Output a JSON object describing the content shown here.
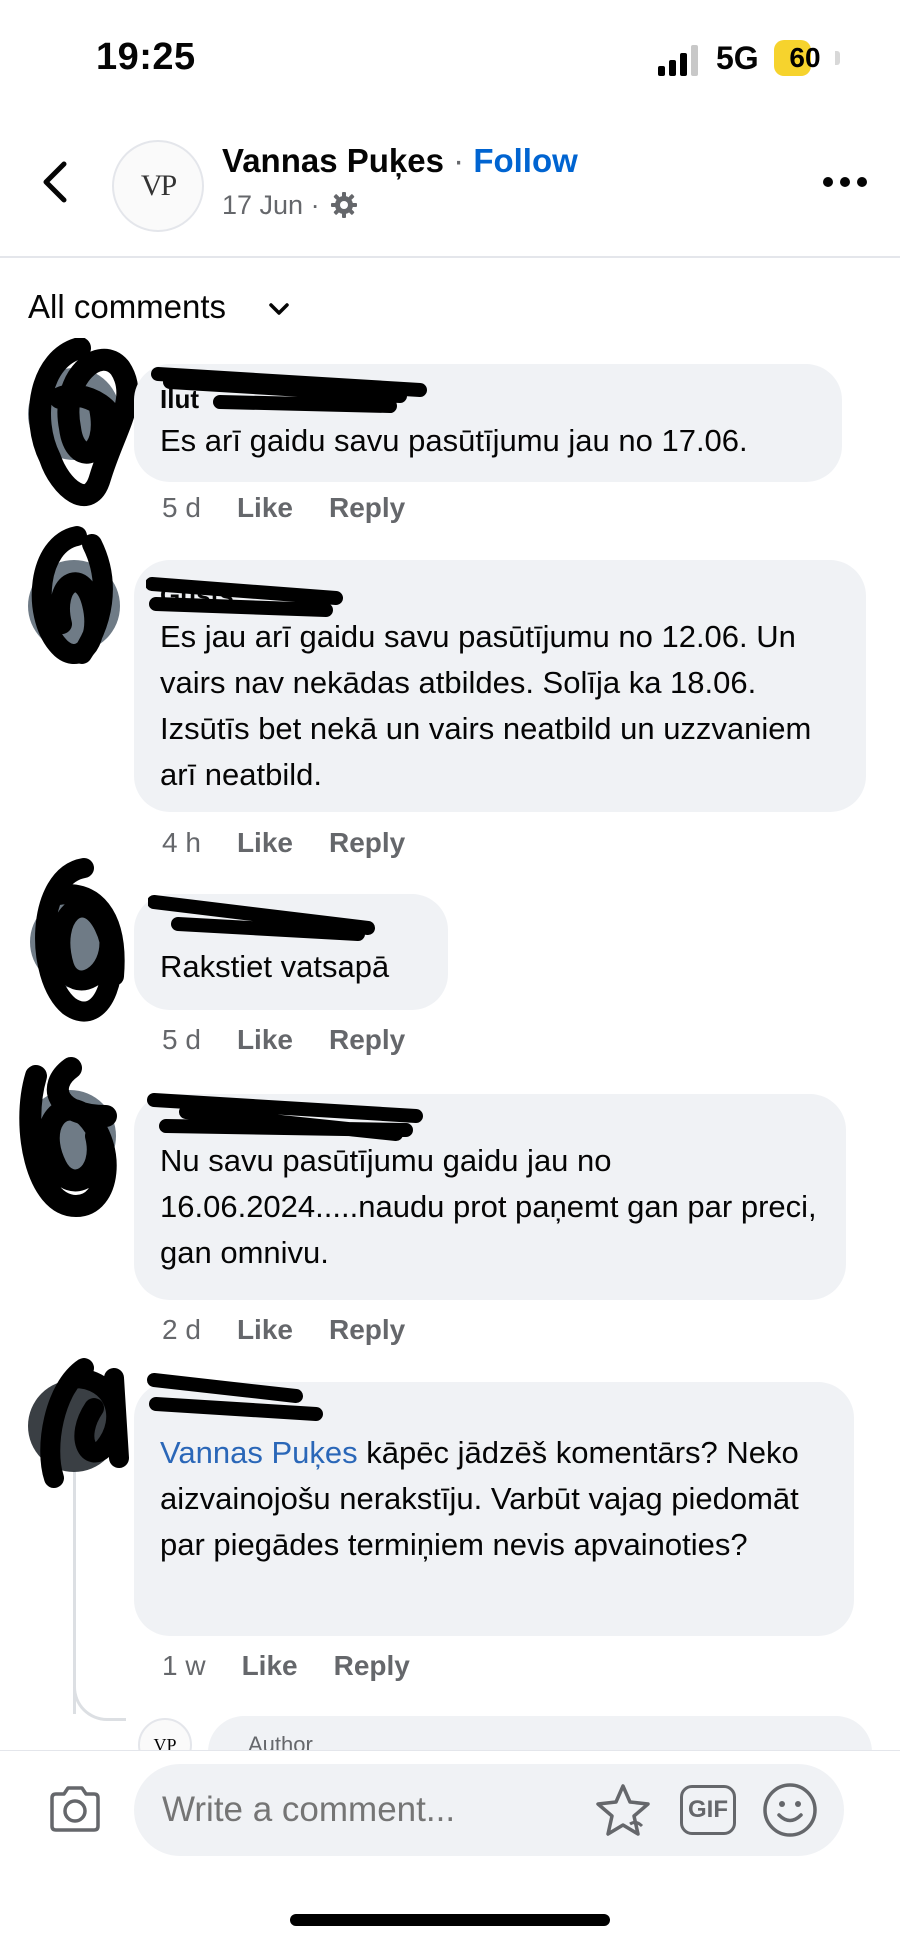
{
  "status_bar": {
    "time": "19:25",
    "network": "5G",
    "battery": "60",
    "battery_level": 0.6
  },
  "header": {
    "page_name": "Vannas Puķes",
    "separator": "·",
    "follow_label": "Follow",
    "date": "17 Jun ·",
    "avatar_text": "VP"
  },
  "filter": {
    "label": "All comments"
  },
  "comments": [
    {
      "author": "Ilut",
      "text": "Es arī gaidu savu pasūtījumu jau no 17.06.",
      "time": "5 d",
      "like": "Like",
      "reply": "Reply"
    },
    {
      "author": "Gusts",
      "text": "Es jau arī gaidu savu pasūtījumu no 12.06. Un vairs nav nekādas atbildes. Solīja ka 18.06. Izsūtīs bet nekā  un vairs neatbild un uzzvaniem arī neatbild.",
      "time": "4 h",
      "like": "Like",
      "reply": "Reply"
    },
    {
      "author": "",
      "text": "Rakstiet vatsapā",
      "time": "5 d",
      "like": "Like",
      "reply": "Reply"
    },
    {
      "author": "",
      "text": "Nu savu pasūtījumu gaidu jau no 16.06.2024.....naudu prot paņemt gan par preci, gan omnivu.",
      "time": "2 d",
      "like": "Like",
      "reply": "Reply"
    },
    {
      "author": "",
      "mention": "Vannas Puķes",
      "text": " kāpēc jādzēš komentārs? Neko aizvainojošu nerakstīju. Varbūt vajag piedomāt par piegādes termiņiem nevis apvainoties?",
      "time": "1 w",
      "like": "Like",
      "reply": "Reply"
    }
  ],
  "reply_preview": {
    "author_badge": "Author",
    "avatar_text": "VP"
  },
  "composer": {
    "placeholder": "Write a comment...",
    "gif_label": "GIF"
  },
  "colors": {
    "accent": "#0064d1",
    "bubble": "#f0f2f5",
    "muted": "#65676b",
    "battery": "#f6d32d"
  }
}
